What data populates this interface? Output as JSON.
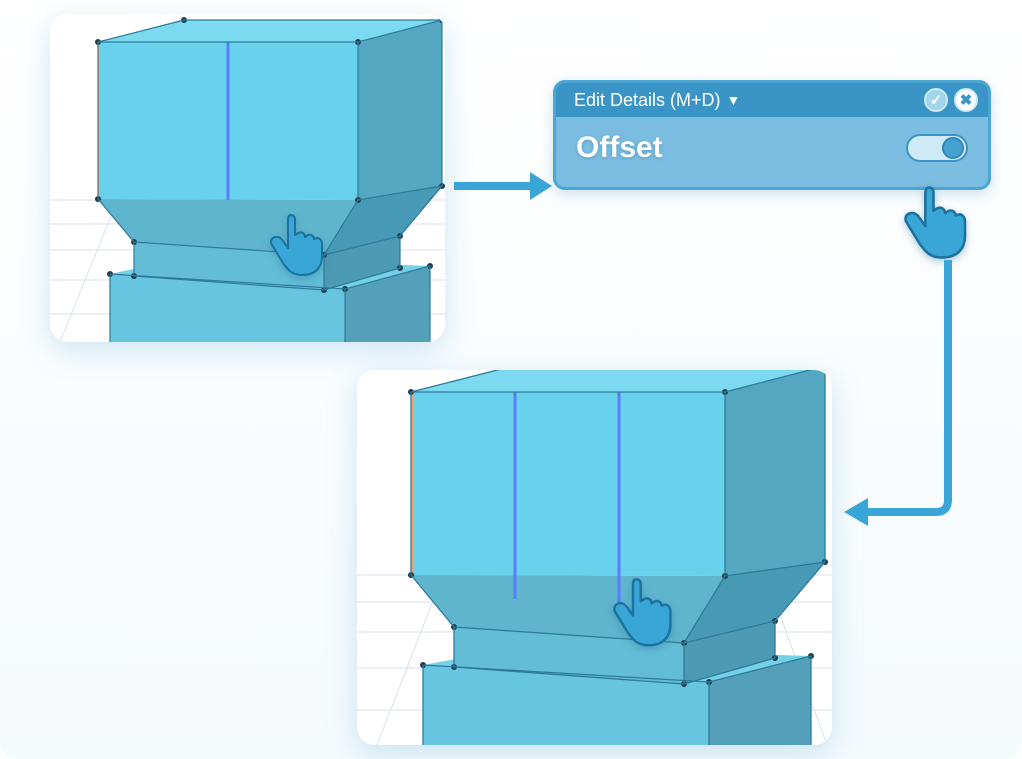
{
  "panel": {
    "header_label": "Edit Details (M+D)",
    "option_label": "Offset",
    "toggle_state": "on",
    "ok_glyph": "✓",
    "close_glyph": "✖"
  },
  "icons": {
    "chevron": "▼"
  },
  "colors": {
    "accent": "#3a94c6",
    "panel_bg": "#7bbde0",
    "model_face_a": "#66d0ec",
    "model_face_b": "#6ab9d3",
    "model_face_c": "#56a7c2",
    "model_face_d": "#4ca3be",
    "hand": "#3aa6d8",
    "edge": "#2d7a9b",
    "selected_edge": "#5a7dff",
    "vertex": "#1f3d4a"
  },
  "viewports": {
    "vp1": {
      "desc": "before-offset 3D cube viewport"
    },
    "vp2": {
      "desc": "after-offset 3D cube viewport"
    }
  }
}
